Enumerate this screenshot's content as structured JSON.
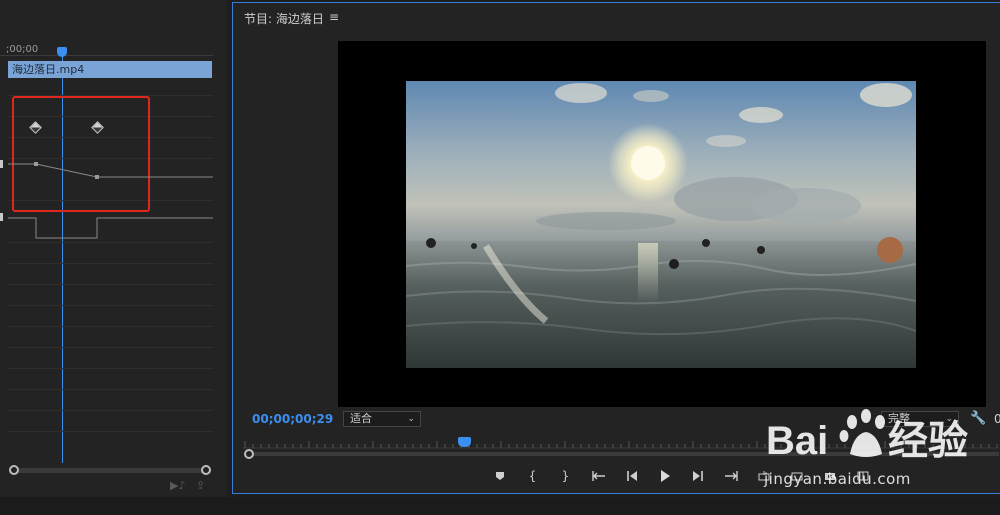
{
  "left_panel": {
    "ruler_time": ";00;00",
    "clip_name": "海边落日.mp4"
  },
  "monitor": {
    "title": "节目: 海边落日",
    "timecode": "00;00;00;29",
    "fit_select": "适合",
    "quality_select": "完整",
    "extra_value": "0"
  },
  "watermark": {
    "url": "jingyan.baidu.com"
  },
  "icons": {
    "menu": "hamburger-icon",
    "wrench": "wrench-icon",
    "marker": "marker-icon",
    "mark_in": "mark-in-icon",
    "mark_out": "mark-out-icon",
    "go_to_in": "go-to-in-icon",
    "step_back": "step-back-icon",
    "play": "play-icon",
    "step_forward": "step-forward-icon",
    "go_to_out": "go-to-out-icon",
    "lift": "lift-icon",
    "extract": "extract-icon",
    "export_frame": "camera-icon",
    "compare": "compare-icon"
  },
  "colors": {
    "accent": "#3b8ff0",
    "clip": "#7aa4d6",
    "highlight": "#e0271d"
  }
}
